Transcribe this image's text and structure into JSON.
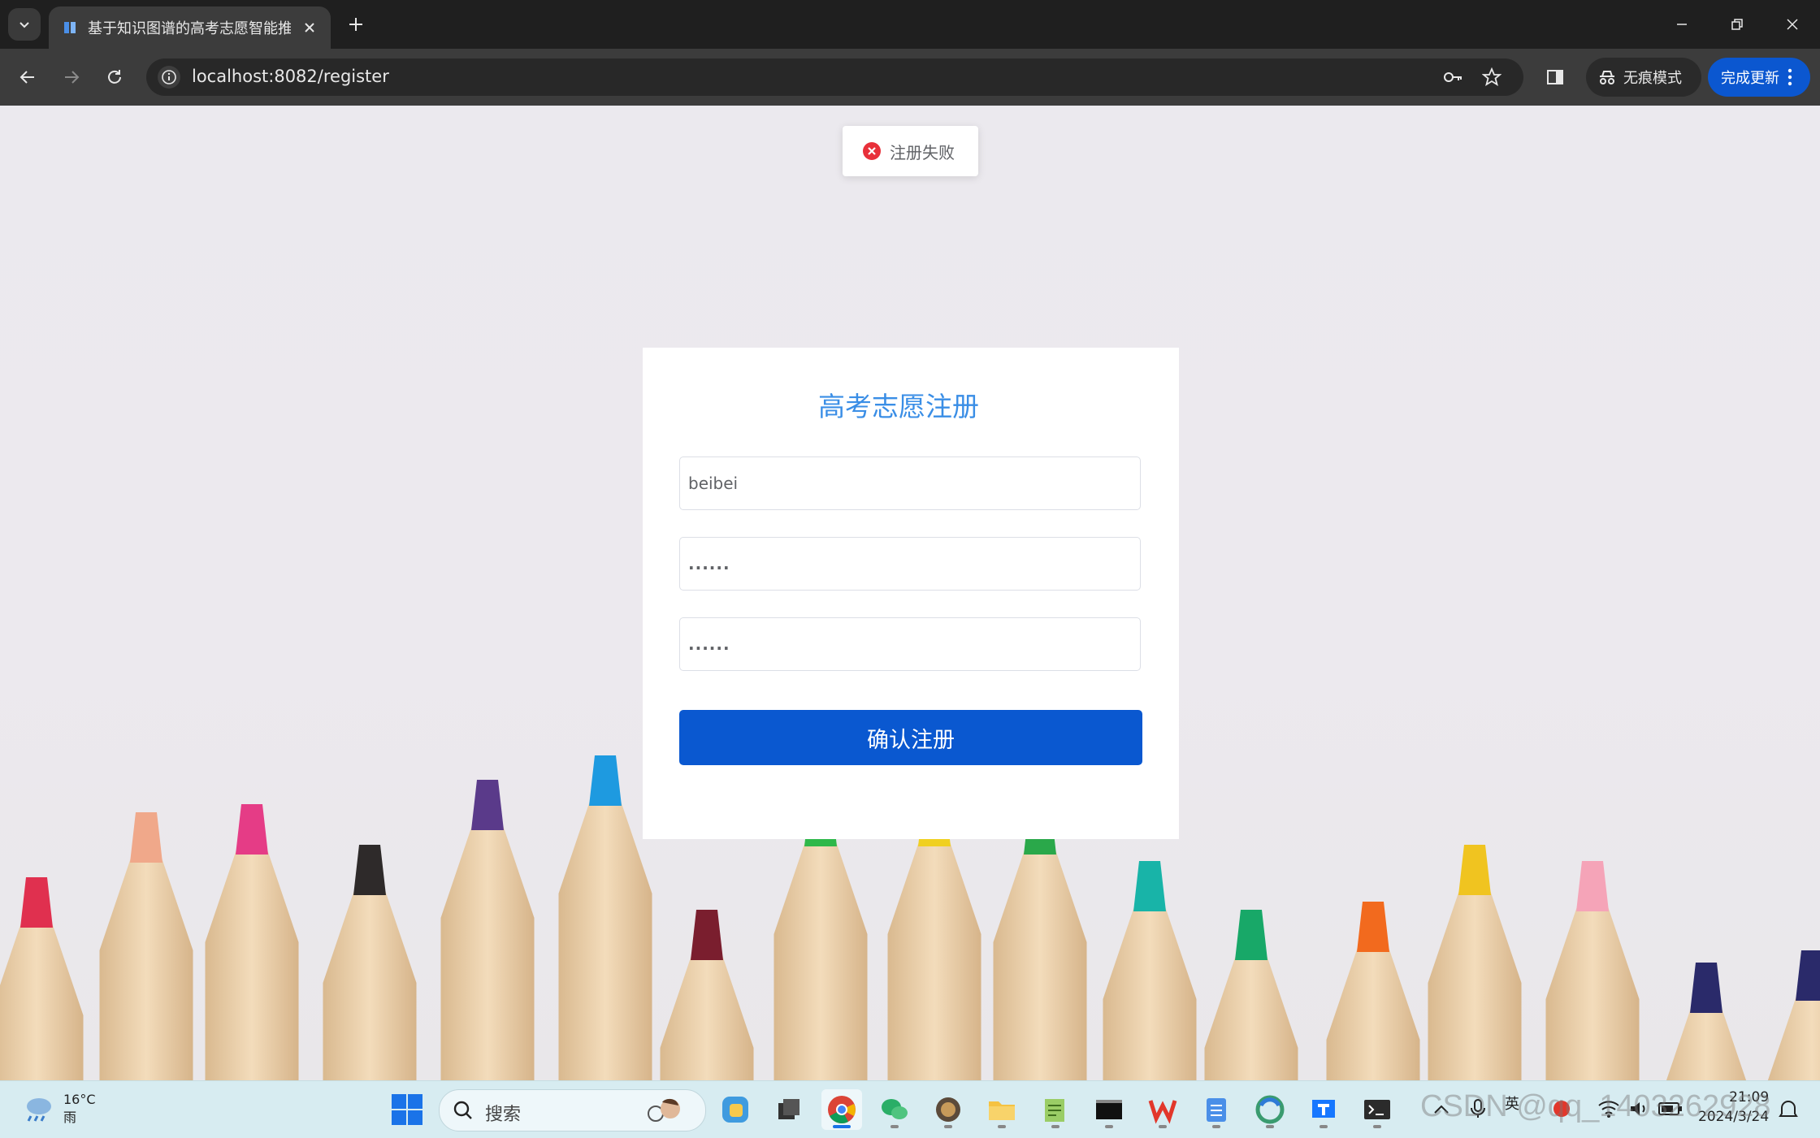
{
  "browser": {
    "tab_title": "基于知识图谱的高考志愿智能推",
    "url": "localhost:8082/register",
    "incognito_label": "无痕模式",
    "update_label": "完成更新"
  },
  "page": {
    "toast_text": "注册失败",
    "form_title": "高考志愿注册",
    "username_value": "beibei",
    "password_value": "......",
    "confirm_value": "......",
    "submit_label": "确认注册"
  },
  "taskbar": {
    "temperature": "16°C",
    "weather": "雨",
    "search_placeholder": "搜索",
    "ime": "英",
    "time": "21:09",
    "date": "2024/3/24",
    "watermark": "CSDN @qq_1403262928"
  },
  "colors": {
    "accent": "#0a58d0",
    "title": "#3a8ee6",
    "error": "#f56c6c"
  }
}
